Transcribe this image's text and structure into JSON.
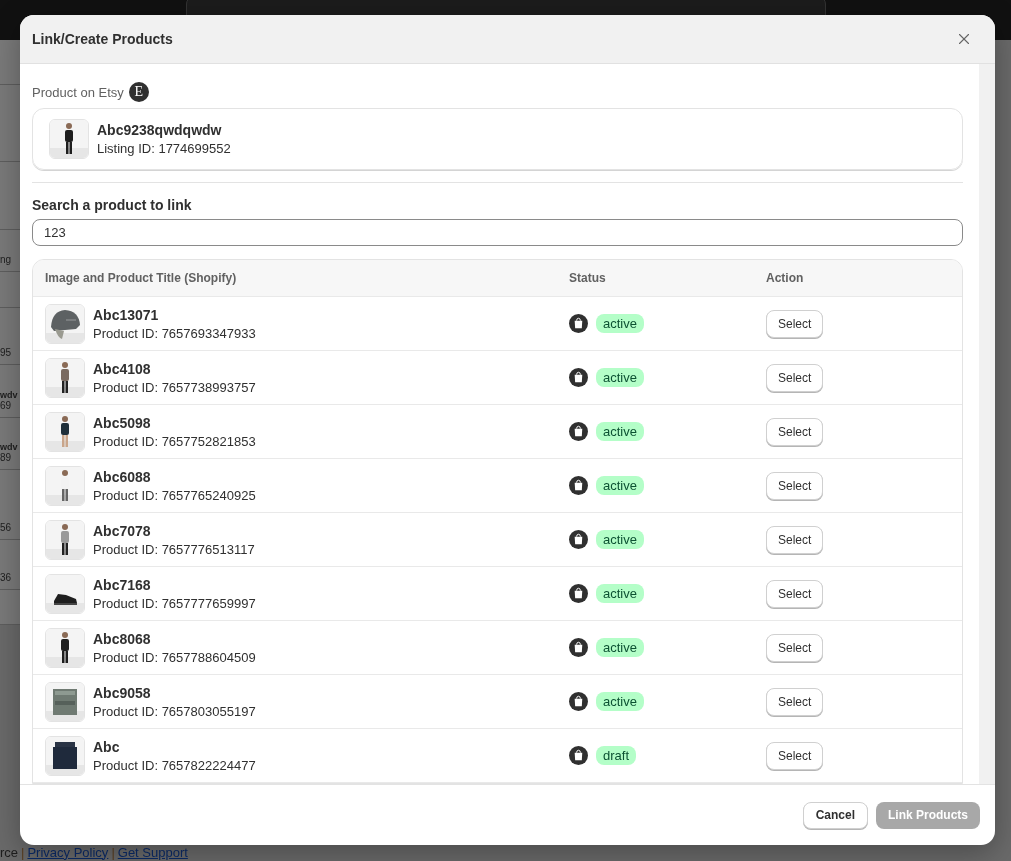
{
  "background": {
    "rows": [
      {
        "sub": "ng"
      },
      {
        "sub": "95"
      },
      {
        "title": "wdv",
        "sub": "69"
      },
      {
        "title": "wdv",
        "sub": "89"
      },
      {
        "sub": "56"
      },
      {
        "sub": "36"
      }
    ],
    "footer": [
      {
        "kind": "text",
        "text": "rce"
      },
      {
        "kind": "separator",
        "text": "|"
      },
      {
        "kind": "link",
        "text": "Privacy Policy"
      },
      {
        "kind": "separator",
        "text": "|"
      },
      {
        "kind": "link",
        "text": "Get Support"
      }
    ]
  },
  "modal": {
    "title": "Link/Create Products",
    "etsy": {
      "label": "Product on Etsy",
      "badge": "E",
      "name": "Abc9238qwdqwdw",
      "listing": "Listing ID: 1774699552"
    },
    "search": {
      "label": "Search a product to link",
      "value": "123"
    },
    "table": {
      "columns": [
        "Image and Product Title (Shopify)",
        "Status",
        "Action"
      ],
      "rows": [
        {
          "title": "Abc13071",
          "id": "Product ID: 7657693347933",
          "status": "active",
          "action": "Select"
        },
        {
          "title": "Abc4108",
          "id": "Product ID: 7657738993757",
          "status": "active",
          "action": "Select"
        },
        {
          "title": "Abc5098",
          "id": "Product ID: 7657752821853",
          "status": "active",
          "action": "Select"
        },
        {
          "title": "Abc6088",
          "id": "Product ID: 7657765240925",
          "status": "active",
          "action": "Select"
        },
        {
          "title": "Abc7078",
          "id": "Product ID: 7657776513117",
          "status": "active",
          "action": "Select"
        },
        {
          "title": "Abc7168",
          "id": "Product ID: 7657777659997",
          "status": "active",
          "action": "Select"
        },
        {
          "title": "Abc8068",
          "id": "Product ID: 7657788604509",
          "status": "active",
          "action": "Select"
        },
        {
          "title": "Abc9058",
          "id": "Product ID: 7657803055197",
          "status": "active",
          "action": "Select"
        },
        {
          "title": "Abc",
          "id": "Product ID: 7657822224477",
          "status": "draft",
          "action": "Select"
        }
      ]
    },
    "buttons": [
      {
        "label": "Cancel",
        "kind": "secondary",
        "disabled": false
      },
      {
        "label": "Link Products",
        "kind": "primary",
        "disabled": true
      }
    ]
  }
}
